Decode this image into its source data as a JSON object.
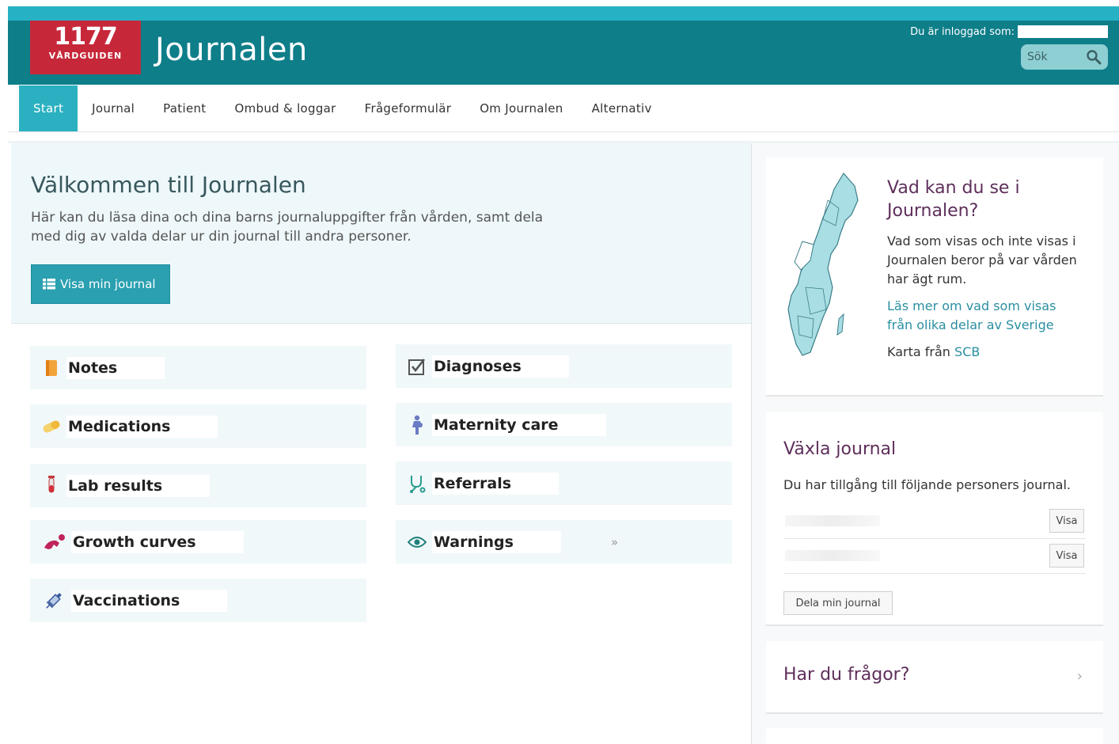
{
  "header": {
    "logo_number": "1177",
    "logo_text": "VÅRDGUIDEN",
    "title": "Journalen",
    "login_text": "Du är inloggad som:",
    "search_placeholder": "Sök"
  },
  "nav": {
    "items": [
      {
        "label": "Start",
        "active": true
      },
      {
        "label": "Journal"
      },
      {
        "label": "Patient"
      },
      {
        "label": "Ombud & loggar"
      },
      {
        "label": "Frågeformulär"
      },
      {
        "label": "Om Journalen"
      },
      {
        "label": "Alternativ"
      }
    ]
  },
  "welcome": {
    "heading": "Välkommen till Journalen",
    "text": "Här kan du läsa dina och dina barns journaluppgifter från vården, samt dela med dig av valda delar ur din journal till andra personer.",
    "button_label": "Visa min journal"
  },
  "tiles": {
    "notes": "Notes",
    "diagnoses": "Diagnoses",
    "medications": "Medications",
    "maternity": "Maternity care",
    "lab": "Lab results",
    "referrals": "Referrals",
    "growth": "Growth curves",
    "warnings": "Warnings",
    "warnings_chevron": "»",
    "vaccinations": "Vaccinations"
  },
  "map_card": {
    "heading": "Vad kan du se i Journalen?",
    "text": "Vad som visas och inte visas i Journalen beror på var vården har ägt rum.",
    "link": "Läs mer om vad som visas från olika delar av Sverige",
    "source_prefix": "Karta från",
    "source_link": "SCB"
  },
  "switch_card": {
    "heading": "Växla journal",
    "text": "Du har tillgång till följande personers journal.",
    "show_label_1": "Visa",
    "show_label_2": "Visa",
    "share_label": "Dela min journal"
  },
  "faq_card": {
    "heading": "Har du frågor?",
    "arrow": "›"
  },
  "colors": {
    "header": "#0e7e89",
    "accent": "#2ab0c1",
    "logo": "#c6283a",
    "heading_purple": "#5e2f5b"
  }
}
